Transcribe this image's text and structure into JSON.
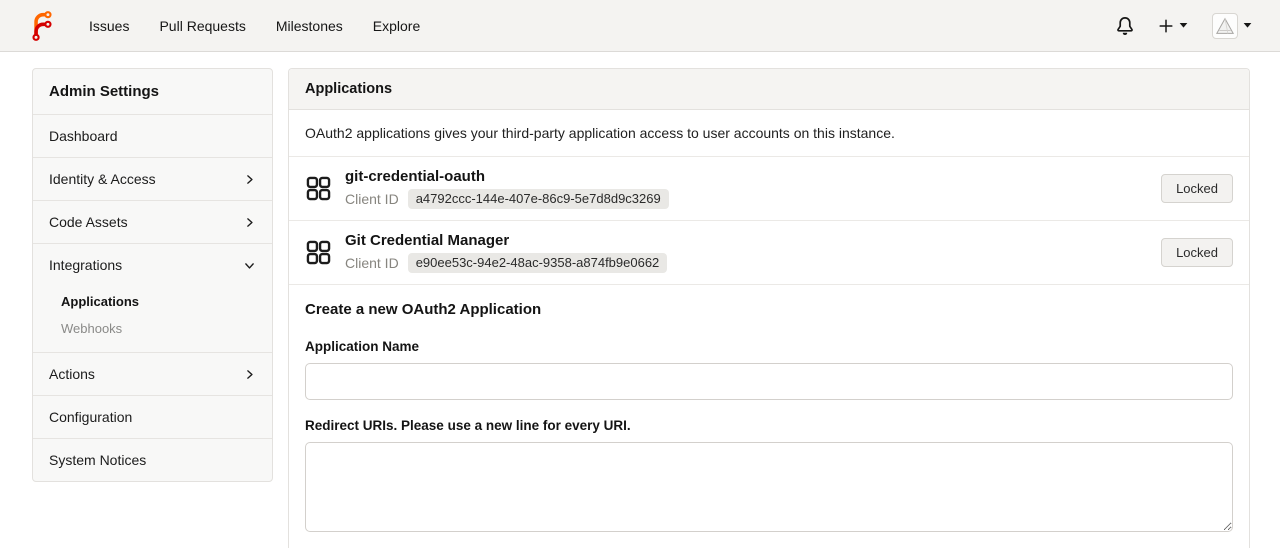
{
  "navbar": {
    "links": [
      {
        "label": "Issues"
      },
      {
        "label": "Pull Requests"
      },
      {
        "label": "Milestones"
      },
      {
        "label": "Explore"
      }
    ],
    "icons": [
      "forgejo-logo",
      "bell-icon",
      "plus-icon",
      "caret-down-icon",
      "avatar"
    ]
  },
  "sidebar": {
    "title": "Admin Settings",
    "items": [
      {
        "label": "Dashboard",
        "chevron": "none"
      },
      {
        "label": "Identity & Access",
        "chevron": "right"
      },
      {
        "label": "Code Assets",
        "chevron": "right"
      },
      {
        "label": "Integrations",
        "chevron": "down"
      },
      {
        "label": "Actions",
        "chevron": "right"
      },
      {
        "label": "Configuration",
        "chevron": "none"
      },
      {
        "label": "System Notices",
        "chevron": "none"
      }
    ],
    "integrations_sub": [
      {
        "label": "Applications",
        "active": true
      },
      {
        "label": "Webhooks",
        "active": false
      }
    ]
  },
  "main": {
    "panel_title": "Applications",
    "description": "OAuth2 applications gives your third-party application access to user accounts on this instance.",
    "client_id_label": "Client ID",
    "apps": [
      {
        "name": "git-credential-oauth",
        "client_id": "a4792ccc-144e-407e-86c9-5e7d8d9c3269",
        "button": "Locked"
      },
      {
        "name": "Git Credential Manager",
        "client_id": "e90ee53c-94e2-48ac-9358-a874fb9e0662",
        "button": "Locked"
      }
    ],
    "create_form": {
      "heading": "Create a new OAuth2 Application",
      "application_name_label": "Application Name",
      "application_name_value": "",
      "redirect_uris_label": "Redirect URIs. Please use a new line for every URI.",
      "redirect_uris_value": ""
    }
  },
  "colors": {
    "logo_orange": "#ff6600",
    "logo_red": "#d40000"
  }
}
